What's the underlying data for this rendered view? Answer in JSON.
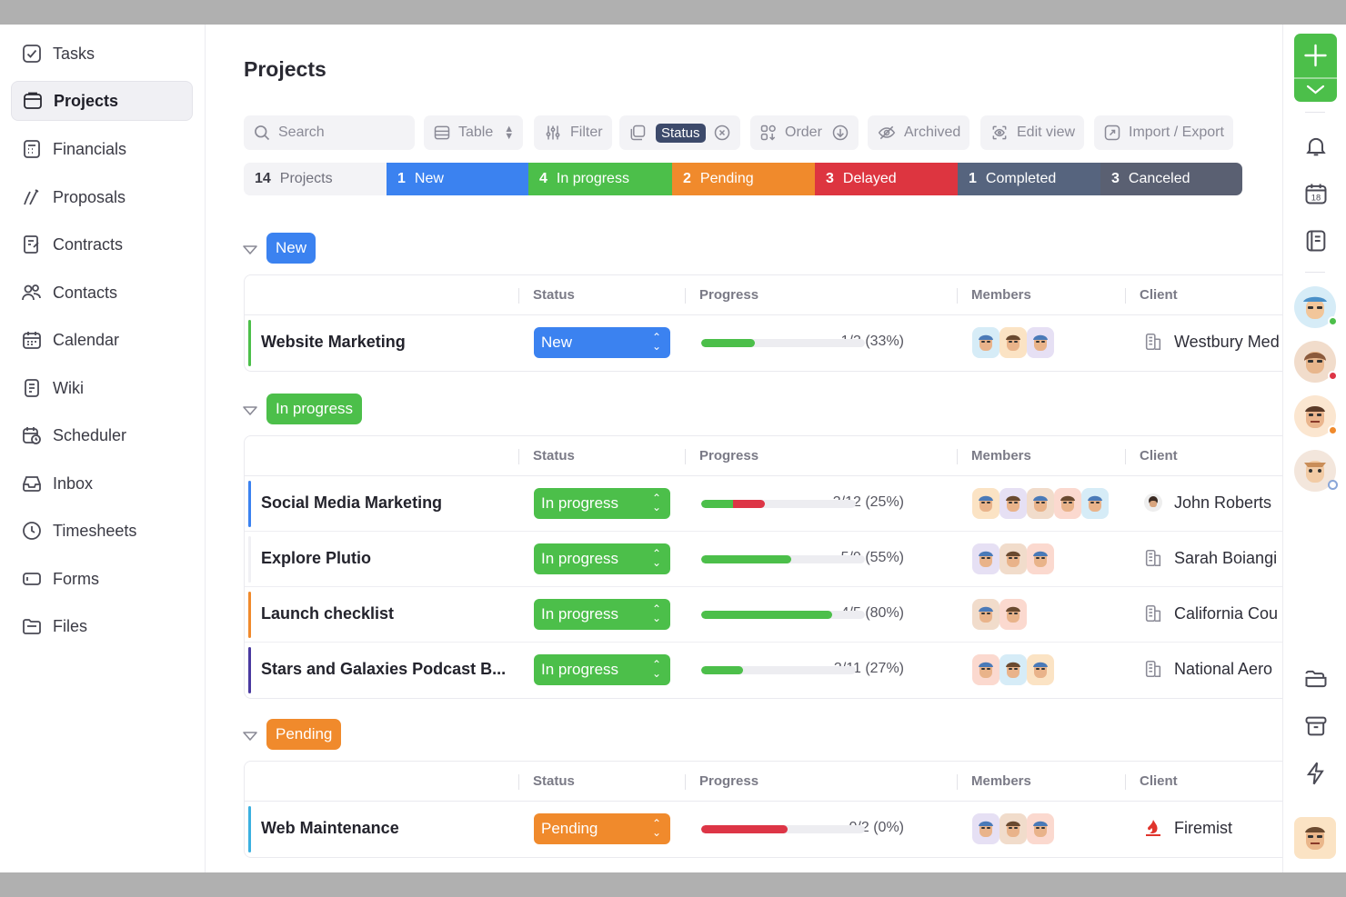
{
  "sidebar": {
    "items": [
      {
        "label": "Tasks",
        "icon": "checkbox-icon"
      },
      {
        "label": "Projects",
        "icon": "folder-icon",
        "active": true
      },
      {
        "label": "Financials",
        "icon": "calculator-icon"
      },
      {
        "label": "Proposals",
        "icon": "pen-icon"
      },
      {
        "label": "Contracts",
        "icon": "contract-icon"
      },
      {
        "label": "Contacts",
        "icon": "contacts-icon"
      },
      {
        "label": "Calendar",
        "icon": "calendar-icon"
      },
      {
        "label": "Wiki",
        "icon": "wiki-icon"
      },
      {
        "label": "Scheduler",
        "icon": "scheduler-icon"
      },
      {
        "label": "Inbox",
        "icon": "inbox-icon"
      },
      {
        "label": "Timesheets",
        "icon": "clock-icon"
      },
      {
        "label": "Forms",
        "icon": "form-icon"
      },
      {
        "label": "Files",
        "icon": "files-icon"
      }
    ]
  },
  "page": {
    "title": "Projects"
  },
  "toolbar": {
    "search_placeholder": "Search",
    "table_label": "Table",
    "filter_label": "Filter",
    "status_chip": "Status",
    "order_label": "Order",
    "archived_label": "Archived",
    "edit_view_label": "Edit view",
    "import_export_label": "Import / Export"
  },
  "summary": {
    "total": {
      "count": "14",
      "label": "Projects"
    },
    "segments": [
      {
        "count": "1",
        "label": "New",
        "color": "#3b82f0"
      },
      {
        "count": "4",
        "label": "In progress",
        "color": "#4cbf4a"
      },
      {
        "count": "2",
        "label": "Pending",
        "color": "#f08a2c"
      },
      {
        "count": "3",
        "label": "Delayed",
        "color": "#dd3540"
      },
      {
        "count": "1",
        "label": "Completed",
        "color": "#56647e"
      },
      {
        "count": "3",
        "label": "Canceled",
        "color": "#5a6072"
      }
    ]
  },
  "columns": {
    "status": "Status",
    "progress": "Progress",
    "members": "Members",
    "client": "Client"
  },
  "groups": [
    {
      "label": "New",
      "color": "#3b82f0",
      "rows": [
        {
          "name": "Website Marketing",
          "status": "New",
          "progress": 0.33,
          "progress_text": "1/3 (33%)",
          "bar_color": "#4cbf4a",
          "accent": "#4cbf4a",
          "members": 3,
          "client": "Westbury Med"
        }
      ]
    },
    {
      "label": "In progress",
      "color": "#4cbf4a",
      "rows": [
        {
          "name": "Social Media Marketing",
          "status": "In progress",
          "progress": 0.25,
          "progress_text": "3/12 (25%)",
          "bar_color": "#dd3546",
          "accent": "#3b82f0",
          "members": 5,
          "client": "John Roberts"
        },
        {
          "name": "Explore Plutio",
          "status": "In progress",
          "progress": 0.55,
          "progress_text": "5/9 (55%)",
          "bar_color": "#4cbf4a",
          "accent": "#ffffff",
          "members": 3,
          "client": "Sarah Boiangi"
        },
        {
          "name": "Launch checklist",
          "status": "In progress",
          "progress": 0.8,
          "progress_text": "4/5 (80%)",
          "bar_color": "#4cbf4a",
          "accent": "#f08a2c",
          "members": 2,
          "client": "California Cou"
        },
        {
          "name": "Stars and Galaxies Podcast B...",
          "status": "In progress",
          "progress": 0.27,
          "progress_text": "3/11 (27%)",
          "bar_color": "#4cbf4a",
          "accent": "#4a3aa0",
          "members": 3,
          "client": "National Aero"
        }
      ]
    },
    {
      "label": "Pending",
      "color": "#f08a2c",
      "rows": [
        {
          "name": "Web Maintenance",
          "status": "Pending",
          "progress": 0.0,
          "progress_text": "0/2 (0%)",
          "bar_color": "#dd3546",
          "accent": "#3bb0e0",
          "members": 3,
          "client": "Firemist"
        }
      ]
    }
  ]
}
